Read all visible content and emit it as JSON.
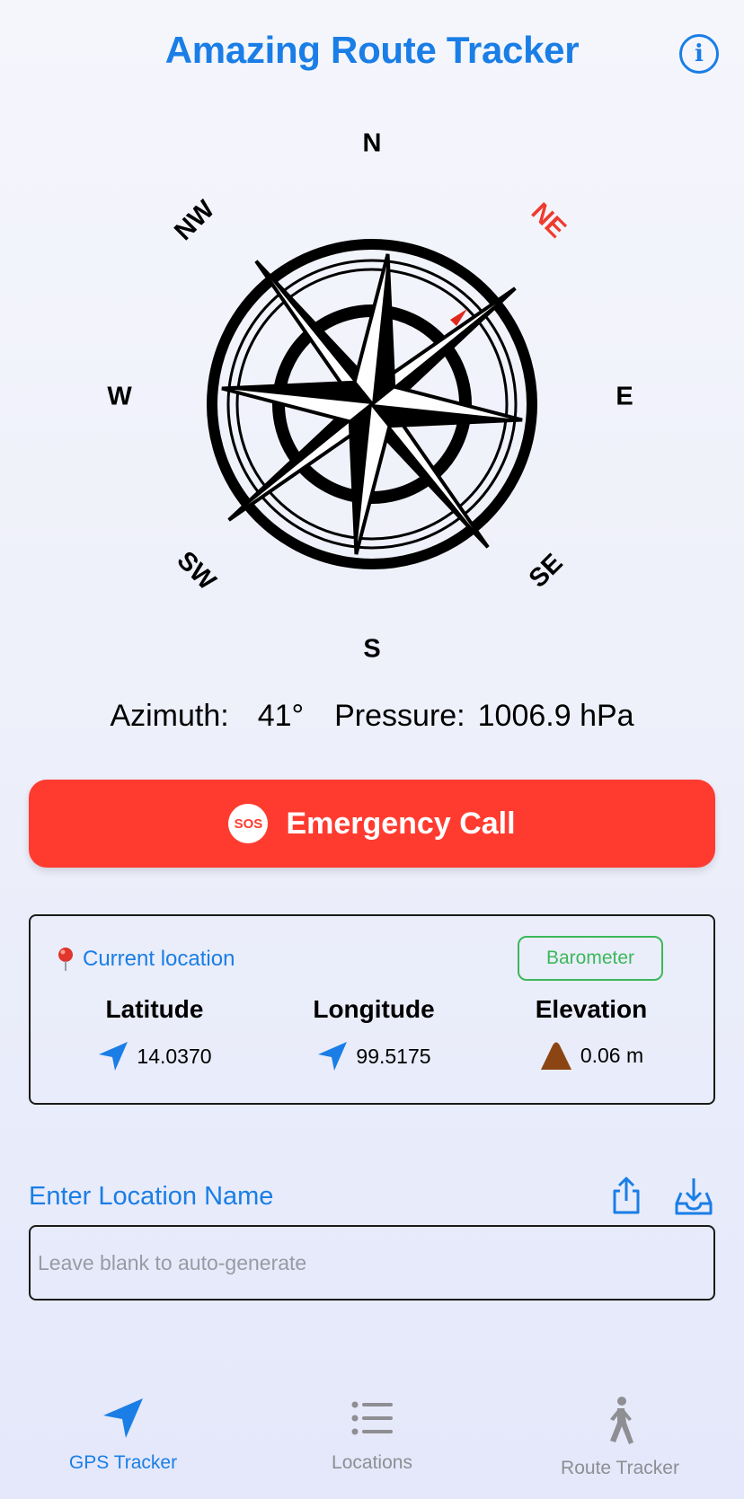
{
  "header": {
    "title": "Amazing Route Tracker",
    "info_icon": "info-circle-icon"
  },
  "compass": {
    "directions": {
      "n": "N",
      "ne": "NE",
      "e": "E",
      "se": "SE",
      "s": "S",
      "sw": "SW",
      "w": "W",
      "nw": "NW"
    },
    "highlight": "NE",
    "highlight_color": "#ee3b2d"
  },
  "readouts": {
    "azimuth_label": "Azimuth:",
    "azimuth_value": "41°",
    "pressure_label": "Pressure:",
    "pressure_value": "1006.9 hPa"
  },
  "sos": {
    "badge": "SOS",
    "label": "Emergency Call",
    "color": "#ff3b30"
  },
  "location": {
    "heading": "Current location",
    "barometer_button": "Barometer",
    "latitude": {
      "label": "Latitude",
      "value": "14.0370",
      "icon": "location-arrow-icon"
    },
    "longitude": {
      "label": "Longitude",
      "value": "99.5175",
      "icon": "location-arrow-icon"
    },
    "elevation": {
      "label": "Elevation",
      "value": "0.06 m",
      "icon": "mountain-icon"
    }
  },
  "name_entry": {
    "label": "Enter Location Name",
    "placeholder": "Leave blank to auto-generate",
    "value": ""
  },
  "tabs": [
    {
      "label": "GPS Tracker",
      "icon": "location-arrow-icon",
      "active": true
    },
    {
      "label": "Locations",
      "icon": "list-icon",
      "active": false
    },
    {
      "label": "Route Tracker",
      "icon": "walking-person-icon",
      "active": false
    }
  ],
  "colors": {
    "accent": "#1a7ee6",
    "green": "#3cb85a",
    "danger": "#ff3b30"
  }
}
